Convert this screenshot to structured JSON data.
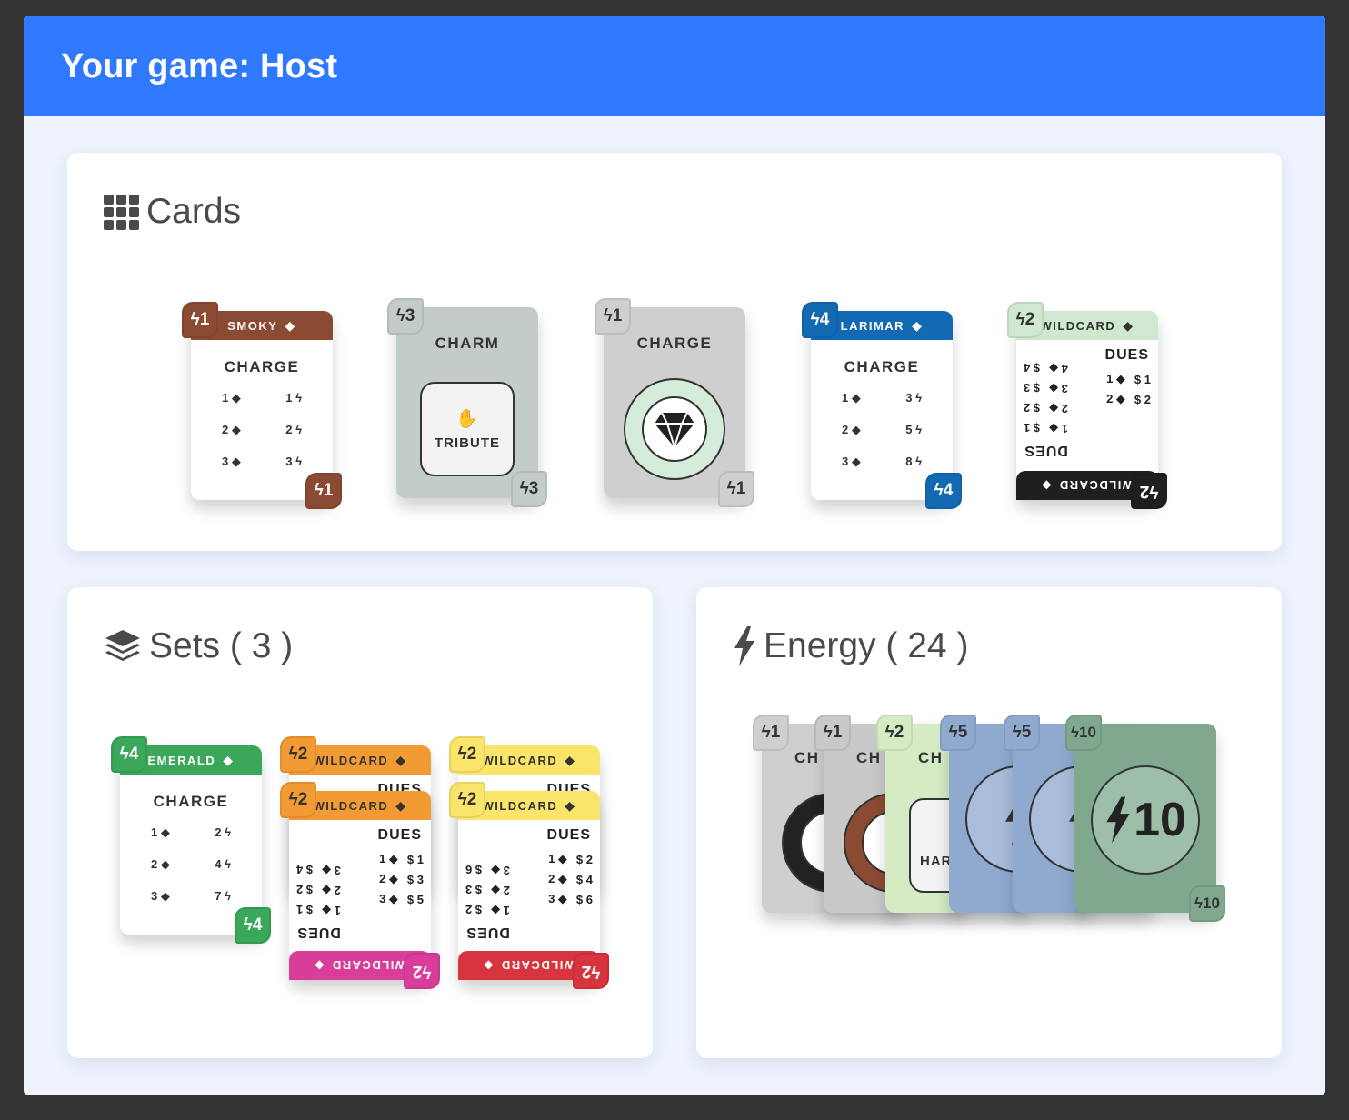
{
  "header": {
    "title": "Your game: Host"
  },
  "panels": {
    "cards": {
      "title": "Cards",
      "icon": "grid-icon"
    },
    "sets": {
      "title": "Sets ( 3 )",
      "icon": "layers-icon"
    },
    "energy": {
      "title": "Energy ( 24 )",
      "icon": "bolt-icon"
    }
  },
  "cards": [
    {
      "type": "charge",
      "name": "SMOKY",
      "cost": "1",
      "title": "CHARGE",
      "rows": [
        [
          "1",
          "1"
        ],
        [
          "2",
          "2"
        ],
        [
          "3",
          "3"
        ]
      ],
      "color": "#8b4b32"
    },
    {
      "type": "charm",
      "cost": "3",
      "title": "CHARM",
      "action": "TRIBUTE",
      "color": "#c4ccc9"
    },
    {
      "type": "charge-wild",
      "cost": "1",
      "title": "CHARGE",
      "color": "#cfcfcf"
    },
    {
      "type": "charge",
      "name": "LARIMAR",
      "cost": "4",
      "title": "CHARGE",
      "rows": [
        [
          "1",
          "3"
        ],
        [
          "2",
          "5"
        ],
        [
          "3",
          "8"
        ]
      ],
      "color": "#1469b3"
    },
    {
      "type": "wildcard",
      "name": "WILDCARD",
      "cost": "2",
      "title": "DUES",
      "dues": [
        [
          "1",
          "$ 1"
        ],
        [
          "2",
          "$ 2"
        ]
      ],
      "upside_dues": [
        [
          "1",
          "$ 1"
        ],
        [
          "2",
          "$ 2"
        ],
        [
          "3",
          "$ 3"
        ],
        [
          "4",
          "$ 4"
        ]
      ],
      "top_color": "#cfe8cf",
      "bottom_color": "#1f1f1f"
    }
  ],
  "sets": [
    {
      "name": "EMERALD",
      "cost": "4",
      "title": "CHARGE",
      "rows": [
        [
          "1",
          "2"
        ],
        [
          "2",
          "4"
        ],
        [
          "3",
          "7"
        ]
      ],
      "color": "#3aa75a"
    },
    {
      "name": "WILDCARD",
      "cost": "2",
      "title": "DUES",
      "dues": [
        [
          "1",
          "$ 1"
        ],
        [
          "2",
          "$ 3"
        ],
        [
          "3",
          "$ 5"
        ]
      ],
      "upside_dues": [
        [
          "1",
          "$ 1"
        ],
        [
          "2",
          "$ 2"
        ],
        [
          "3",
          "$ 4"
        ]
      ],
      "top_color": "#f29a33",
      "bottom_color": "#d93d9a"
    },
    {
      "name": "WILDCARD",
      "cost": "2",
      "title": "DUES",
      "dues": [
        [
          "1",
          "$ 2"
        ],
        [
          "2",
          "$ 4"
        ],
        [
          "3",
          "$ 6"
        ]
      ],
      "upside_dues": [
        [
          "1",
          "$ 2"
        ],
        [
          "2",
          "$ 3"
        ],
        [
          "3",
          "$ 6"
        ]
      ],
      "top_color": "#fbe46a",
      "bottom_color": "#d8343d"
    }
  ],
  "set_back_labels": {
    "dues_peek": "DUES"
  },
  "energy": {
    "stack": [
      {
        "cost": "1",
        "label": "CH",
        "color": "#cfcfcf"
      },
      {
        "cost": "1",
        "label": "CH",
        "color": "#c9c9c9"
      },
      {
        "cost": "2",
        "label": "CH",
        "color": "#d4ebc4"
      },
      {
        "cost": "5",
        "color": "#8fa9cf"
      },
      {
        "cost": "5",
        "color": "#8fa9cf"
      },
      {
        "cost": "10",
        "color": "#7fa88f"
      }
    ],
    "top_value": "10",
    "partial_action": "HAR"
  }
}
